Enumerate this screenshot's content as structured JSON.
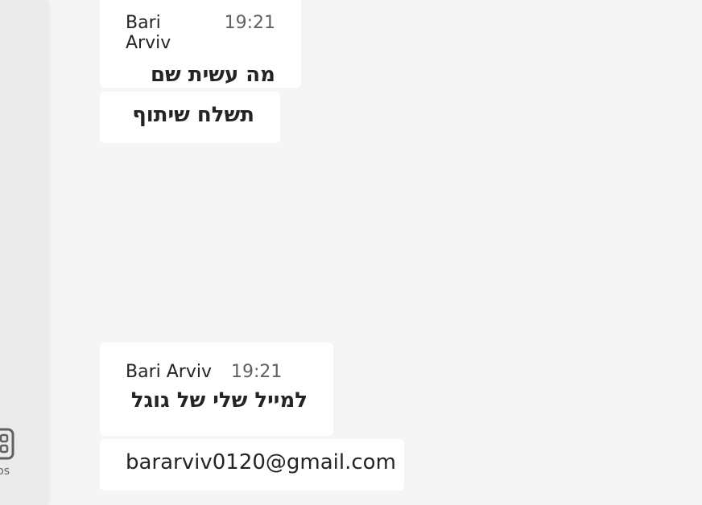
{
  "left_rail": {
    "app_label": "ps",
    "app_icon": "apps-icon"
  },
  "messages": [
    {
      "sender": "Bari Arviv",
      "time": "19:21",
      "text": "מה עשית שם"
    },
    {
      "text": "תשלח שיתוף"
    },
    {
      "sender": "Bari Arviv",
      "time": "19:21",
      "text": "למייל שלי של גוגל"
    },
    {
      "text": "bararviv0120@gmail.com"
    }
  ]
}
